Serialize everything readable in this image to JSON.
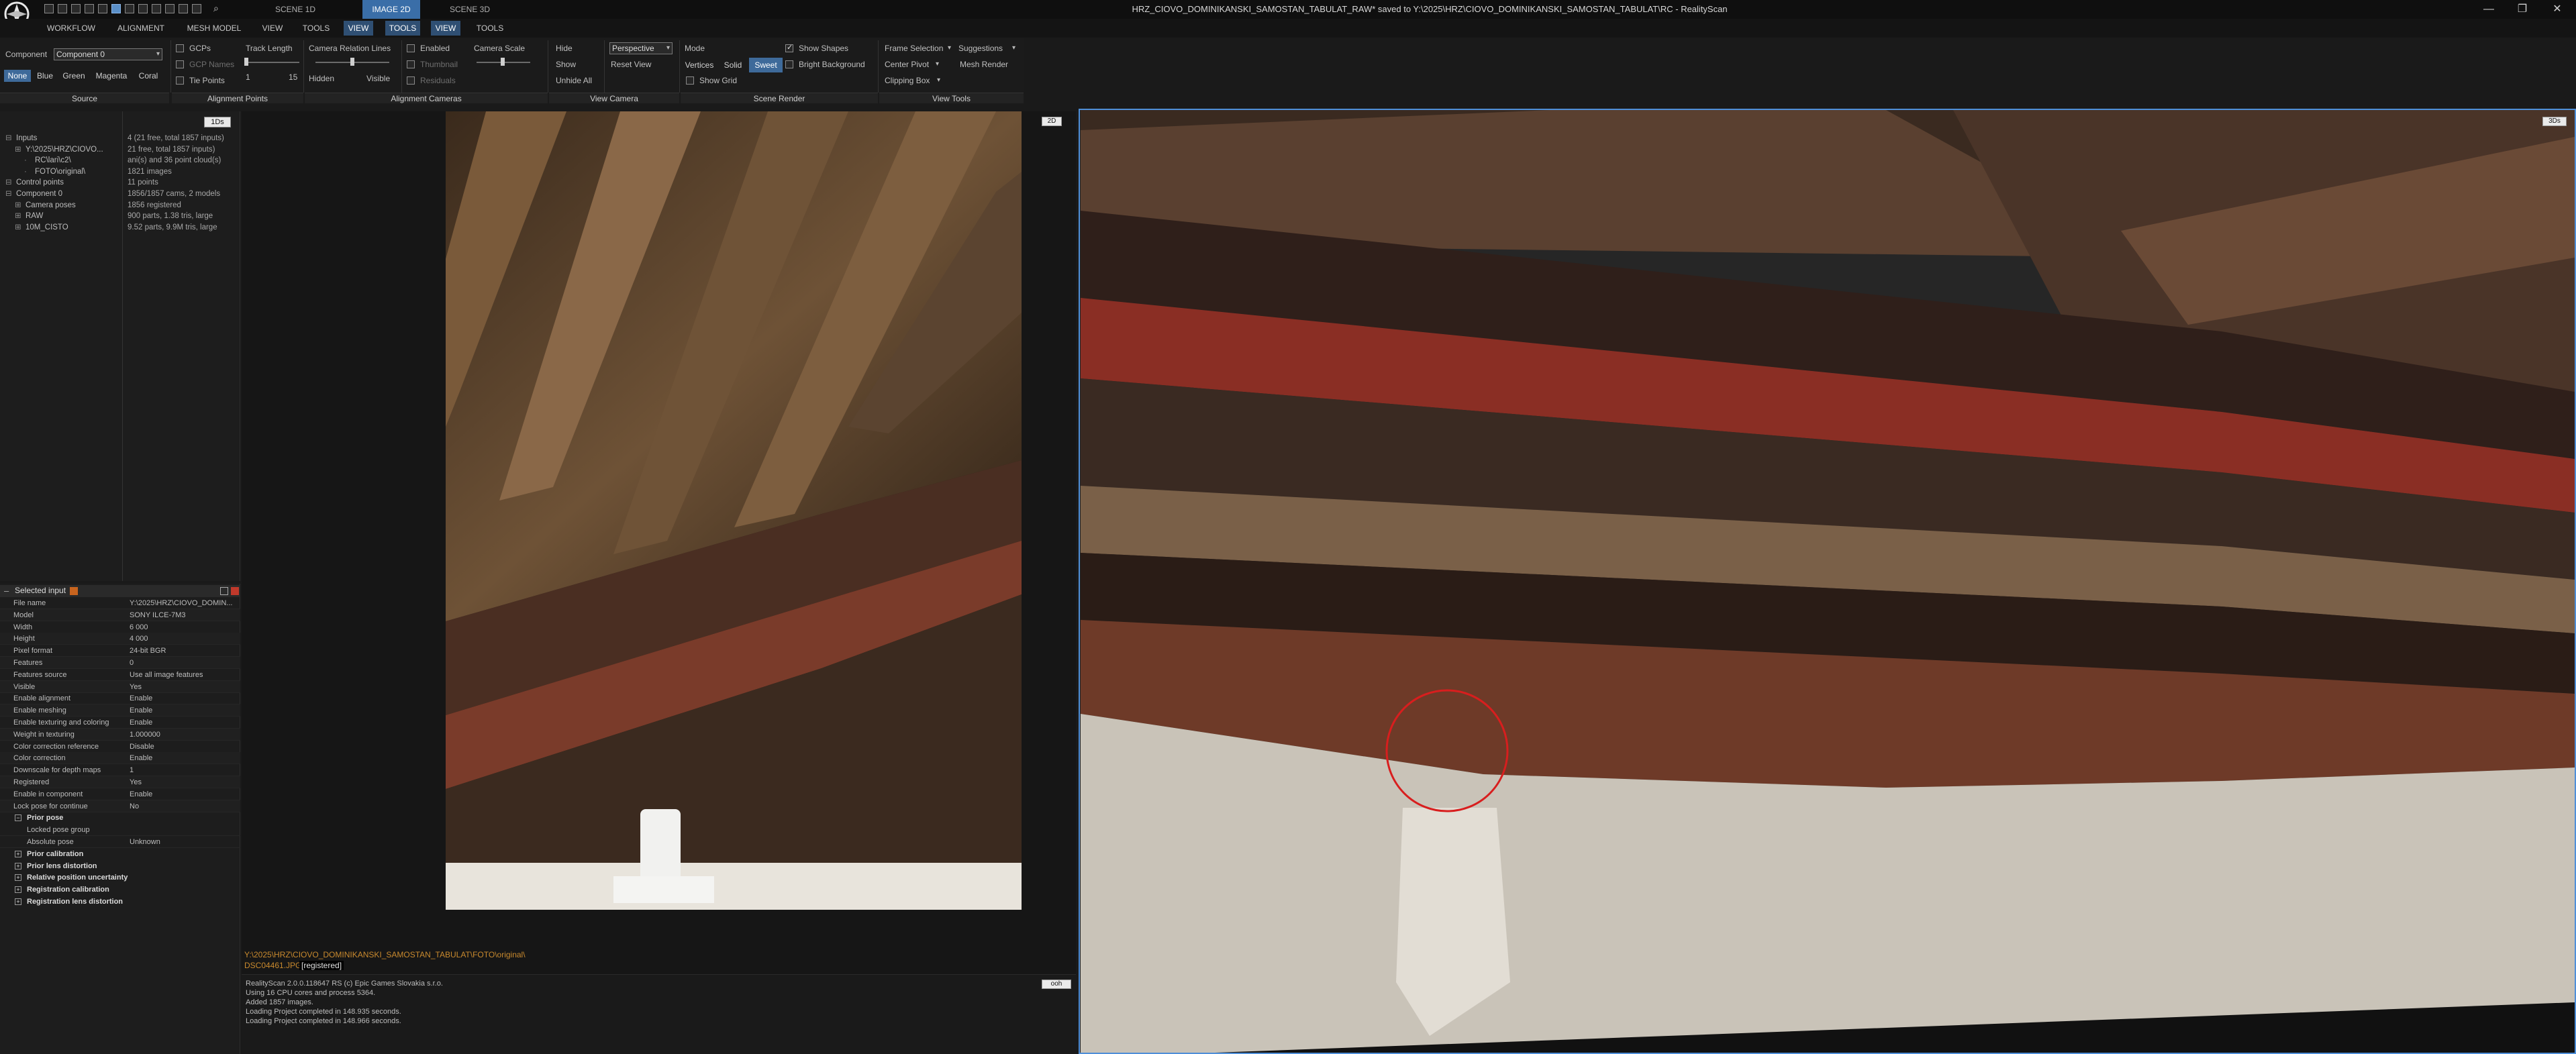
{
  "window": {
    "title": "HRZ_CIOVO_DOMINIKANSKI_SAMOSTAN_TABULAT_RAW* saved to Y:\\2025\\HRZ\\CIOVO_DOMINIKANSKI_SAMOSTAN_TABULAT\\RC - RealityScan",
    "minimize": "—",
    "maximize": "❐",
    "close": "✕",
    "search_glyph": "⌕"
  },
  "scene_tabs": [
    {
      "label": "SCENE 1D",
      "active": false
    },
    {
      "label": "IMAGE 2D",
      "active": true
    },
    {
      "label": "SCENE 3D",
      "active": false
    }
  ],
  "menu": [
    "WORKFLOW",
    "ALIGNMENT",
    "MESH MODEL",
    "VIEW",
    "TOOLS",
    "VIEW",
    "TOOLS",
    "VIEW",
    "TOOLS"
  ],
  "ribbon": {
    "component_label": "Component",
    "component_value": "Component 0",
    "colors": [
      "None",
      "Blue",
      "Green",
      "Magenta",
      "Coral"
    ],
    "source_label": "Source",
    "gcps": "GCPs",
    "gcp_names": "GCP Names",
    "tie_points": "Tie Points",
    "track_length": "Track Length",
    "track_min": "1",
    "track_max": "15",
    "alignment_points_label": "Alignment Points",
    "camera_relation_lines": "Camera Relation Lines",
    "hidden": "Hidden",
    "visible": "Visible",
    "enabled": "Enabled",
    "thumbnail": "Thumbnail",
    "residuals": "Residuals",
    "camera_scale": "Camera Scale",
    "alignment_cameras_label": "Alignment Cameras",
    "hide": "Hide",
    "show": "Show",
    "unhide_all": "Unhide All",
    "projection": "Perspective",
    "reset_view": "Reset View",
    "view_camera_label": "View Camera",
    "mode": "Mode",
    "modes": [
      "Vertices",
      "Solid",
      "Sweet"
    ],
    "show_grid": "Show Grid",
    "show_shapes": "Show Shapes",
    "bright_background": "Bright Background",
    "scene_render_label": "Scene Render",
    "frame_selection": "Frame Selection",
    "suggestions": "Suggestions",
    "center_pivot": "Center Pivot",
    "mesh_render": "Mesh Render",
    "clipping_box": "Clipping Box",
    "view_tools_label": "View Tools"
  },
  "tree": {
    "badge": "1Ds",
    "rows": [
      {
        "name": "Inputs",
        "value": "4 (21 free, total 1857 inputs)",
        "indent": 0
      },
      {
        "name": "Y:\\2025\\HRZ\\CIOVO...",
        "value": "21 free, total 1857 inputs)",
        "indent": 1
      },
      {
        "name": "RC\\lari\\c2\\",
        "value": "ani(s) and 36 point cloud(s)",
        "indent": 2
      },
      {
        "name": "FOTO\\original\\",
        "value": "1821 images",
        "indent": 2
      },
      {
        "name": "Control points",
        "value": "11 points",
        "indent": 0
      },
      {
        "name": "Component 0",
        "value": "1856/1857 cams, 2 models",
        "indent": 0
      },
      {
        "name": "Camera poses",
        "value": "1856 registered",
        "indent": 1
      },
      {
        "name": "RAW",
        "value": "900 parts, 1.38 tris, large",
        "indent": 1
      },
      {
        "name": "10M_CISTO",
        "value": "9.52 parts, 9.9M tris, large",
        "indent": 1
      }
    ]
  },
  "selected_input": {
    "header": "Selected input",
    "props": [
      {
        "k": "File name",
        "v": "Y:\\2025\\HRZ\\CIOVO_DOMIN..."
      },
      {
        "k": "Model",
        "v": "SONY ILCE-7M3"
      },
      {
        "k": "Width",
        "v": "6 000"
      },
      {
        "k": "Height",
        "v": "4 000"
      },
      {
        "k": "Pixel format",
        "v": "24-bit BGR"
      },
      {
        "k": "Features",
        "v": "0"
      },
      {
        "k": "Features source",
        "v": "Use all image features"
      },
      {
        "k": "Visible",
        "v": "Yes"
      },
      {
        "k": "Enable alignment",
        "v": "Enable"
      },
      {
        "k": "Enable meshing",
        "v": "Enable"
      },
      {
        "k": "Enable texturing and coloring",
        "v": "Enable"
      },
      {
        "k": "Weight in texturing",
        "v": "1.000000"
      },
      {
        "k": "Color correction reference",
        "v": "Disable"
      },
      {
        "k": "Color correction",
        "v": "Enable"
      },
      {
        "k": "Downscale for depth maps",
        "v": "1"
      },
      {
        "k": "Registered",
        "v": "Yes"
      },
      {
        "k": "Enable in component",
        "v": "Enable"
      },
      {
        "k": "Lock pose for continue",
        "v": "No"
      }
    ],
    "prior_pose": "Prior pose",
    "sub_props": [
      {
        "k": "Locked pose group",
        "v": ""
      },
      {
        "k": "Absolute pose",
        "v": "Unknown"
      }
    ],
    "groups": [
      "Prior calibration",
      "Prior lens distortion",
      "Relative position uncertainty",
      "Registration calibration",
      "Registration lens distortion"
    ]
  },
  "view2d": {
    "badge": "2D",
    "path": "Y:\\2025\\HRZ\\CIOVO_DOMINIKANSKI_SAMOSTAN_TABULAT\\FOTO\\original\\",
    "file": "DSC04461.JPG",
    "status": "[registered]",
    "console_badge": "ooh",
    "console": [
      "RealityScan 2.0.0.118647 RS (c) Epic Games Slovakia s.r.o.",
      "Using 16 CPU cores and process 5364.",
      "Added 1857 images.",
      "Loading Project completed in 148.935 seconds.",
      "Loading Project completed in 148.966 seconds."
    ]
  },
  "view3d": {
    "badge": "3Ds"
  }
}
